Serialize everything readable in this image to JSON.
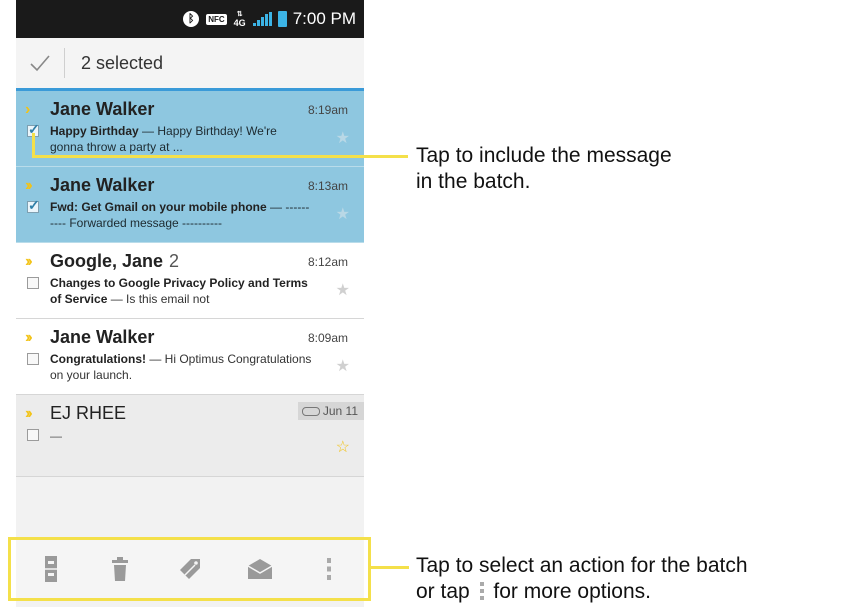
{
  "status_bar": {
    "bluetooth_icon": "bluetooth-icon",
    "nfc_label": "NFC",
    "network_label_top": "4G",
    "time": "7:00 PM"
  },
  "action_bar": {
    "selected_text": "2 selected"
  },
  "messages": [
    {
      "sender": "Jane Walker",
      "time": "8:19am",
      "subject": "Happy Birthday",
      "preview": " — Happy Birthday! We're gonna throw a party at ...",
      "selected": true
    },
    {
      "sender": "Jane Walker",
      "time": "8:13am",
      "subject": "Fwd: Get Gmail on your mobile phone",
      "preview": " — ---------- Forwarded message ----------",
      "selected": true
    },
    {
      "sender": "Google, Jane",
      "count": "2",
      "time": "8:12am",
      "subject": "Changes to Google Privacy Policy and Terms of Service",
      "preview": " — Is this email not",
      "selected": false
    },
    {
      "sender": "Jane Walker",
      "time": "8:09am",
      "subject": "Congratulations!",
      "preview": " — Hi Optimus Congratulations on your launch.",
      "selected": false
    },
    {
      "sender": "EJ RHEE",
      "time": "Jun 11",
      "subject": "",
      "preview": "—",
      "selected": false
    }
  ],
  "bottom_actions": [
    "archive-icon",
    "delete-icon",
    "label-icon",
    "mark-unread-icon",
    "overflow-menu-icon"
  ],
  "callouts": {
    "first_line1": "Tap to include the message",
    "first_line2": "in the batch.",
    "second_line1": "Tap to select an action for the batch",
    "second_line2_a": "or tap",
    "second_line2_b": "for more options."
  },
  "colors": {
    "selected_row": "#8ec7e0",
    "highlight": "#f4e04a",
    "accent_blue": "#3a9ad8",
    "star_gold": "#f2c318"
  }
}
